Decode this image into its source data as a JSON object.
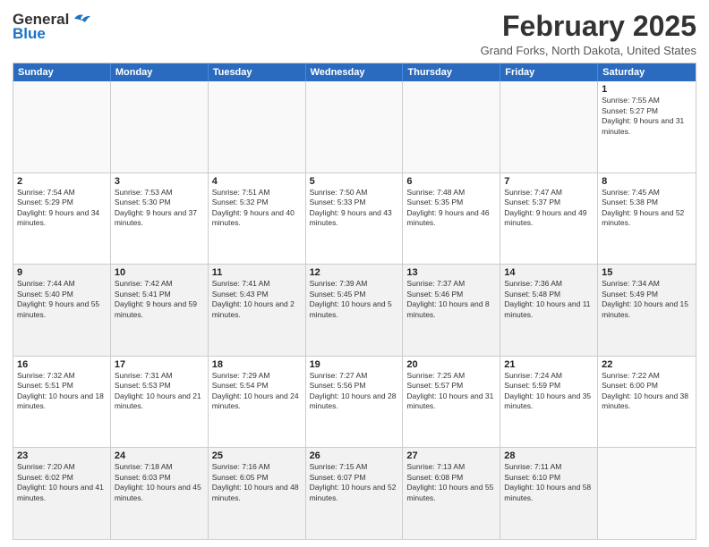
{
  "header": {
    "logo_general": "General",
    "logo_blue": "Blue",
    "month_year": "February 2025",
    "location": "Grand Forks, North Dakota, United States"
  },
  "days_of_week": [
    "Sunday",
    "Monday",
    "Tuesday",
    "Wednesday",
    "Thursday",
    "Friday",
    "Saturday"
  ],
  "weeks": [
    [
      {
        "day": "",
        "info": "",
        "empty": true
      },
      {
        "day": "",
        "info": "",
        "empty": true
      },
      {
        "day": "",
        "info": "",
        "empty": true
      },
      {
        "day": "",
        "info": "",
        "empty": true
      },
      {
        "day": "",
        "info": "",
        "empty": true
      },
      {
        "day": "",
        "info": "",
        "empty": true
      },
      {
        "day": "1",
        "info": "Sunrise: 7:55 AM\nSunset: 5:27 PM\nDaylight: 9 hours and 31 minutes."
      }
    ],
    [
      {
        "day": "2",
        "info": "Sunrise: 7:54 AM\nSunset: 5:29 PM\nDaylight: 9 hours and 34 minutes."
      },
      {
        "day": "3",
        "info": "Sunrise: 7:53 AM\nSunset: 5:30 PM\nDaylight: 9 hours and 37 minutes."
      },
      {
        "day": "4",
        "info": "Sunrise: 7:51 AM\nSunset: 5:32 PM\nDaylight: 9 hours and 40 minutes."
      },
      {
        "day": "5",
        "info": "Sunrise: 7:50 AM\nSunset: 5:33 PM\nDaylight: 9 hours and 43 minutes."
      },
      {
        "day": "6",
        "info": "Sunrise: 7:48 AM\nSunset: 5:35 PM\nDaylight: 9 hours and 46 minutes."
      },
      {
        "day": "7",
        "info": "Sunrise: 7:47 AM\nSunset: 5:37 PM\nDaylight: 9 hours and 49 minutes."
      },
      {
        "day": "8",
        "info": "Sunrise: 7:45 AM\nSunset: 5:38 PM\nDaylight: 9 hours and 52 minutes."
      }
    ],
    [
      {
        "day": "9",
        "info": "Sunrise: 7:44 AM\nSunset: 5:40 PM\nDaylight: 9 hours and 55 minutes.",
        "shade": true
      },
      {
        "day": "10",
        "info": "Sunrise: 7:42 AM\nSunset: 5:41 PM\nDaylight: 9 hours and 59 minutes.",
        "shade": true
      },
      {
        "day": "11",
        "info": "Sunrise: 7:41 AM\nSunset: 5:43 PM\nDaylight: 10 hours and 2 minutes.",
        "shade": true
      },
      {
        "day": "12",
        "info": "Sunrise: 7:39 AM\nSunset: 5:45 PM\nDaylight: 10 hours and 5 minutes.",
        "shade": true
      },
      {
        "day": "13",
        "info": "Sunrise: 7:37 AM\nSunset: 5:46 PM\nDaylight: 10 hours and 8 minutes.",
        "shade": true
      },
      {
        "day": "14",
        "info": "Sunrise: 7:36 AM\nSunset: 5:48 PM\nDaylight: 10 hours and 11 minutes.",
        "shade": true
      },
      {
        "day": "15",
        "info": "Sunrise: 7:34 AM\nSunset: 5:49 PM\nDaylight: 10 hours and 15 minutes.",
        "shade": true
      }
    ],
    [
      {
        "day": "16",
        "info": "Sunrise: 7:32 AM\nSunset: 5:51 PM\nDaylight: 10 hours and 18 minutes."
      },
      {
        "day": "17",
        "info": "Sunrise: 7:31 AM\nSunset: 5:53 PM\nDaylight: 10 hours and 21 minutes."
      },
      {
        "day": "18",
        "info": "Sunrise: 7:29 AM\nSunset: 5:54 PM\nDaylight: 10 hours and 24 minutes."
      },
      {
        "day": "19",
        "info": "Sunrise: 7:27 AM\nSunset: 5:56 PM\nDaylight: 10 hours and 28 minutes."
      },
      {
        "day": "20",
        "info": "Sunrise: 7:25 AM\nSunset: 5:57 PM\nDaylight: 10 hours and 31 minutes."
      },
      {
        "day": "21",
        "info": "Sunrise: 7:24 AM\nSunset: 5:59 PM\nDaylight: 10 hours and 35 minutes."
      },
      {
        "day": "22",
        "info": "Sunrise: 7:22 AM\nSunset: 6:00 PM\nDaylight: 10 hours and 38 minutes."
      }
    ],
    [
      {
        "day": "23",
        "info": "Sunrise: 7:20 AM\nSunset: 6:02 PM\nDaylight: 10 hours and 41 minutes.",
        "shade": true
      },
      {
        "day": "24",
        "info": "Sunrise: 7:18 AM\nSunset: 6:03 PM\nDaylight: 10 hours and 45 minutes.",
        "shade": true
      },
      {
        "day": "25",
        "info": "Sunrise: 7:16 AM\nSunset: 6:05 PM\nDaylight: 10 hours and 48 minutes.",
        "shade": true
      },
      {
        "day": "26",
        "info": "Sunrise: 7:15 AM\nSunset: 6:07 PM\nDaylight: 10 hours and 52 minutes.",
        "shade": true
      },
      {
        "day": "27",
        "info": "Sunrise: 7:13 AM\nSunset: 6:08 PM\nDaylight: 10 hours and 55 minutes.",
        "shade": true
      },
      {
        "day": "28",
        "info": "Sunrise: 7:11 AM\nSunset: 6:10 PM\nDaylight: 10 hours and 58 minutes.",
        "shade": true
      },
      {
        "day": "",
        "info": "",
        "empty": true,
        "shade": false
      }
    ]
  ]
}
